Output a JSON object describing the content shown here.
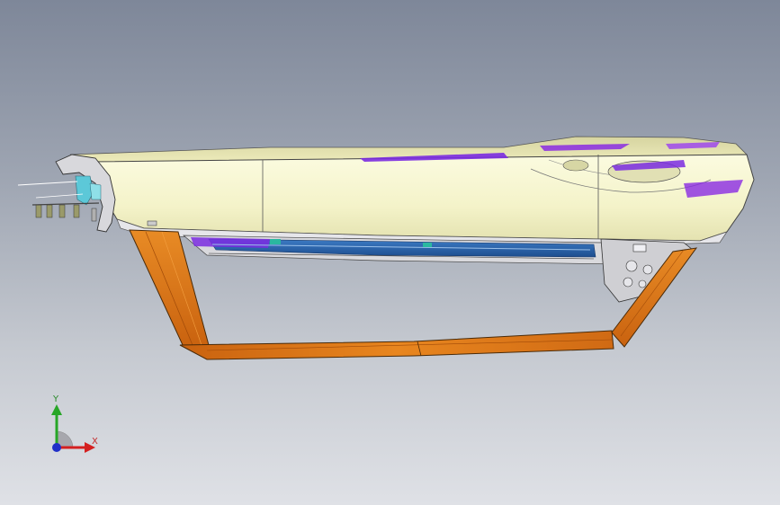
{
  "viewport": {
    "background_top": "#7e8799",
    "background_bottom": "#dfe1e6"
  },
  "model": {
    "body_color": "#f7f7cf",
    "frame_color": "#e07a18",
    "highlight_color": "#8a2be2",
    "channel_color": "#2e6db8",
    "bracket_color": "#5cc8d8"
  },
  "triad": {
    "x_label": "X",
    "y_label": "Y",
    "x_color": "#d42020",
    "y_color": "#27a627",
    "z_color": "#2030c8"
  }
}
